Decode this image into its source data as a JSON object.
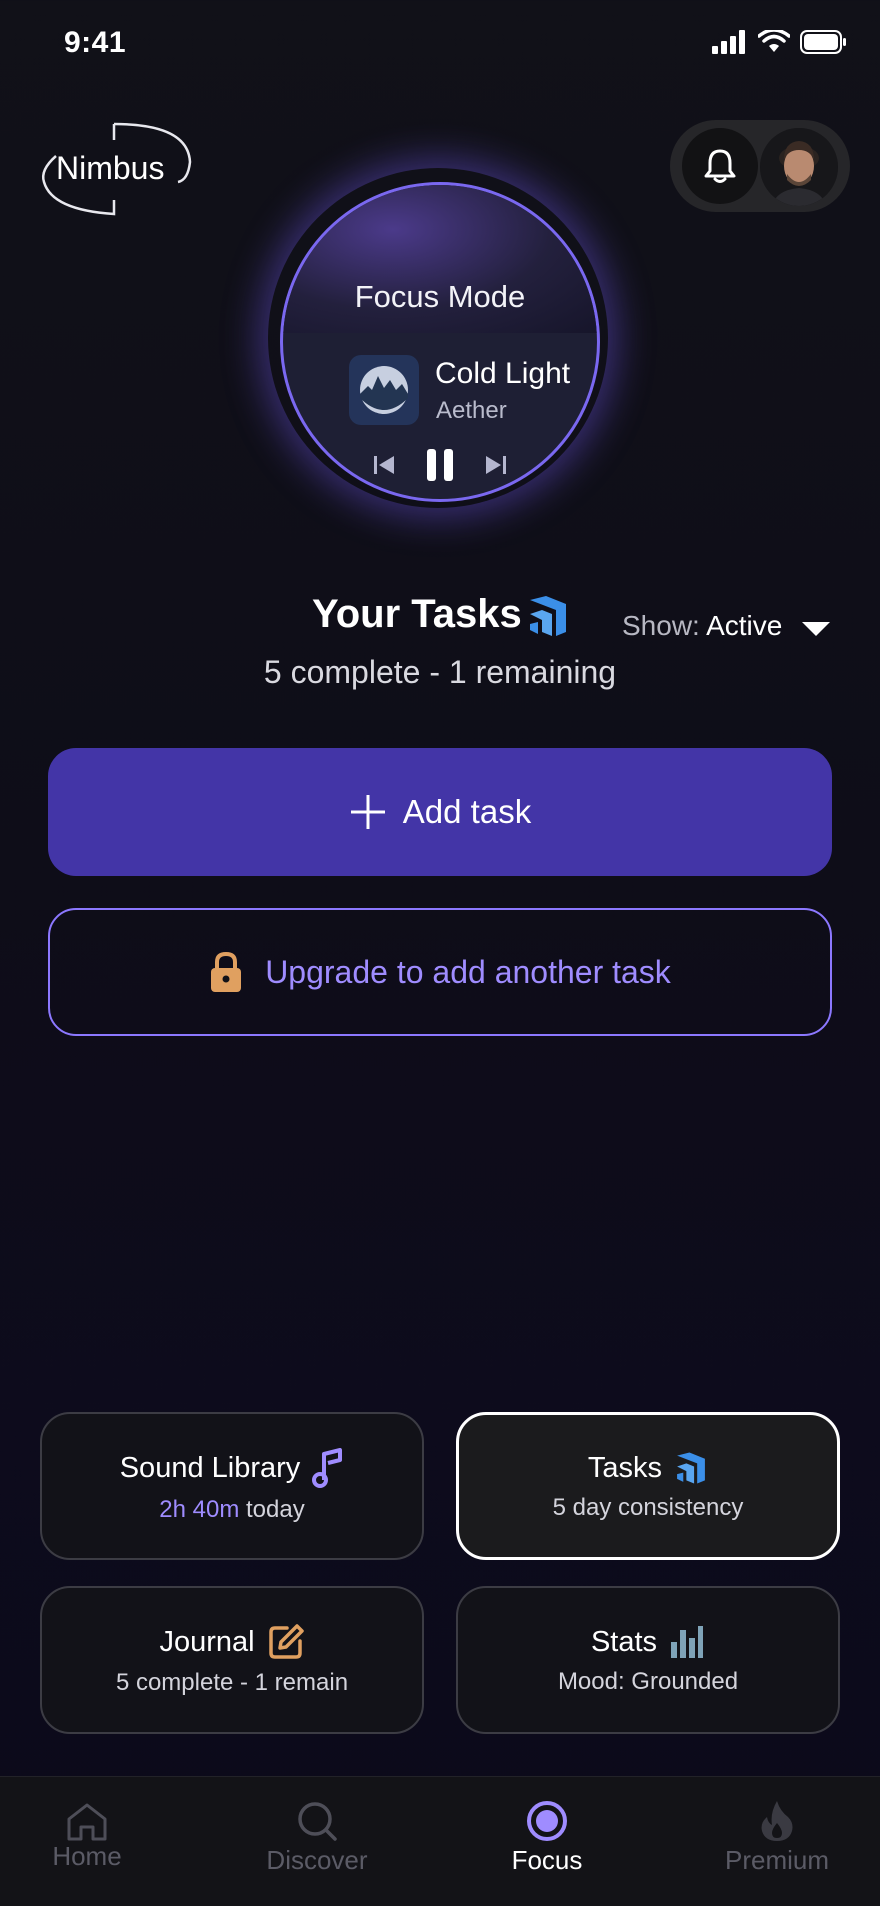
{
  "status_bar": {
    "time": "9:41"
  },
  "header": {
    "logo_text": "Nimbus"
  },
  "now_playing": {
    "mode_title": "Focus Mode",
    "song": "Cold Light",
    "artist": "Aether"
  },
  "tasks": {
    "title": "Your Tasks",
    "show_label": "Show:",
    "show_value": "Active",
    "summary": "5 complete - 1 remaining",
    "add_label": "Add task",
    "upgrade_label": "Upgrade to add another task"
  },
  "cards": {
    "sound_library": {
      "title": "Sound Library",
      "sub_highlight": "2h 40m",
      "sub_rest": " today"
    },
    "tasks": {
      "title": "Tasks",
      "sub": "5 day consistency"
    },
    "journal": {
      "title": "Journal",
      "sub": "5 complete - 1 remain"
    },
    "stats": {
      "title": "Stats",
      "sub": "Mood: Grounded"
    }
  },
  "nav": {
    "items": [
      {
        "label": "Home"
      },
      {
        "label": "Discover"
      },
      {
        "label": "Focus"
      },
      {
        "label": "Premium"
      }
    ],
    "active": "Focus"
  },
  "colors": {
    "accent": "#4335a7",
    "accent_light": "#9f8cff",
    "lock": "#e0a060",
    "blue_icon": "#3b8fe8"
  },
  "icons": [
    "signal-icon",
    "wifi-icon",
    "battery-icon",
    "bell-icon",
    "music-note-icon",
    "tasks-logo-icon",
    "edit-icon",
    "stats-icon",
    "lock-icon",
    "plus-icon",
    "home-icon",
    "search-icon",
    "focus-icon",
    "flame-icon",
    "chevron-down-icon",
    "prev-icon",
    "pause-icon",
    "next-icon"
  ]
}
